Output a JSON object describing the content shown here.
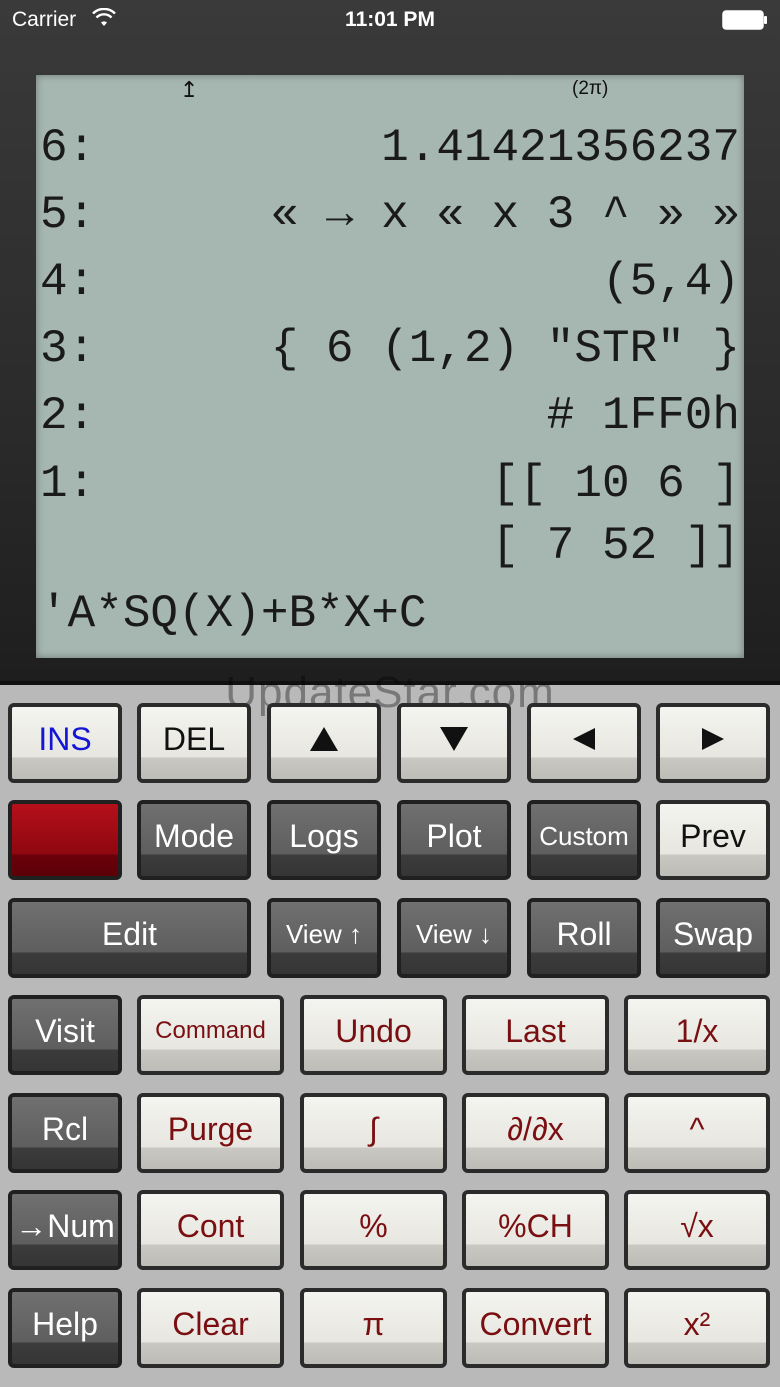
{
  "status_bar": {
    "carrier": "Carrier",
    "time": "11:01 PM",
    "icons": [
      "wifi-icon",
      "battery-icon"
    ]
  },
  "display": {
    "annunciators": {
      "shift": "↥",
      "angle": "(2π)"
    },
    "stack": [
      {
        "level": "6:",
        "value": "1.41421356237"
      },
      {
        "level": "5:",
        "value": "« → x « x 3 ^ » »"
      },
      {
        "level": "4:",
        "value": "(5,4)"
      },
      {
        "level": "3:",
        "value": "{ 6 (1,2) \"STR\" }"
      },
      {
        "level": "2:",
        "value": "# 1FF0h"
      },
      {
        "level": "1:",
        "value": "[[ 10 6 ]"
      },
      {
        "level": "",
        "value": "[ 7 52 ]]"
      }
    ],
    "command_line": "'A*SQ(X)+B*X+C"
  },
  "watermark": "UpdateStar.com",
  "keys": {
    "ins": "INS",
    "del": "DEL",
    "mode": "Mode",
    "logs": "Logs",
    "plot": "Plot",
    "custom": "Custom",
    "prev": "Prev",
    "edit": "Edit",
    "view_up": "View ↑",
    "view_down": "View ↓",
    "roll": "Roll",
    "swap": "Swap",
    "visit": "Visit",
    "command": "Command",
    "undo": "Undo",
    "last": "Last",
    "inv": "1/x",
    "rcl": "Rcl",
    "purge": "Purge",
    "integral": "∫",
    "deriv": "∂/∂x",
    "power": "^",
    "to_num": "→Num",
    "cont": "Cont",
    "percent": "%",
    "percent_ch": "%CH",
    "sqrt": "√x",
    "help": "Help",
    "clear": "Clear",
    "pi": "π",
    "convert": "Convert",
    "square": "x²"
  },
  "colors": {
    "lcd": "#a6b6b1",
    "shift_key": "#8e0710",
    "maroon_text": "#7a0f12",
    "ins_text": "#1515d6"
  }
}
